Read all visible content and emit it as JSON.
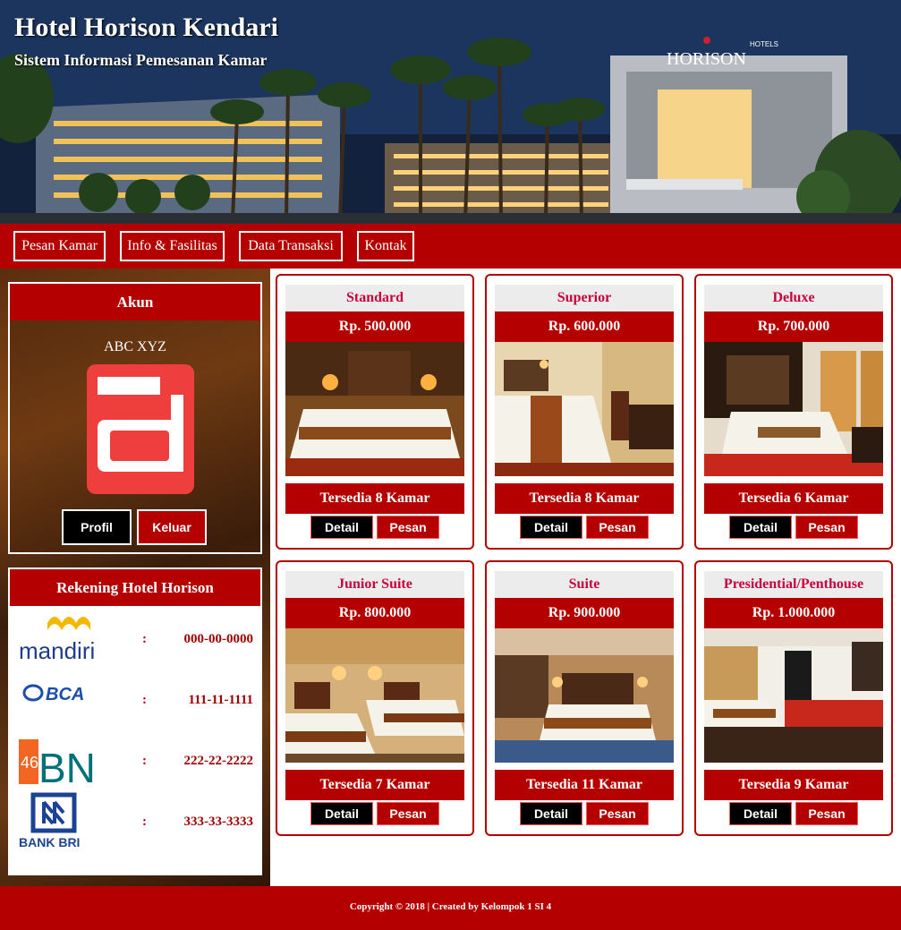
{
  "header": {
    "title": "Hotel Horison Kendari",
    "subtitle": "Sistem Informasi Pemesanan Kamar",
    "building_sign": "HORISON",
    "building_sign_small": "HOTELS"
  },
  "nav": {
    "items": [
      {
        "label": "Pesan Kamar"
      },
      {
        "label": "Info & Fasilitas"
      },
      {
        "label": "Data Transaksi"
      },
      {
        "label": "Kontak"
      }
    ]
  },
  "account": {
    "title": "Akun",
    "user_name": "ABC XYZ",
    "avatar_letter": "a",
    "profile_label": "Profil",
    "logout_label": "Keluar"
  },
  "rekening": {
    "title": "Rekening Hotel Horison",
    "separator": ":",
    "banks": [
      {
        "bank": "mandiri",
        "number": "000-00-0000"
      },
      {
        "bank": "BCA",
        "number": "111-11-1111"
      },
      {
        "bank": "BNI",
        "number": "222-22-2222"
      },
      {
        "bank": "BANK BRI",
        "number": "333-33-3333"
      }
    ]
  },
  "rooms": [
    {
      "name": "Standard",
      "price": "Rp. 500.000",
      "availability": "Tersedia 8 Kamar",
      "detail_label": "Detail",
      "book_label": "Pesan"
    },
    {
      "name": "Superior",
      "price": "Rp. 600.000",
      "availability": "Tersedia 8 Kamar",
      "detail_label": "Detail",
      "book_label": "Pesan"
    },
    {
      "name": "Deluxe",
      "price": "Rp. 700.000",
      "availability": "Tersedia 6 Kamar",
      "detail_label": "Detail",
      "book_label": "Pesan"
    },
    {
      "name": "Junior Suite",
      "price": "Rp. 800.000",
      "availability": "Tersedia 7 Kamar",
      "detail_label": "Detail",
      "book_label": "Pesan"
    },
    {
      "name": "Suite",
      "price": "Rp. 900.000",
      "availability": "Tersedia 11 Kamar",
      "detail_label": "Detail",
      "book_label": "Pesan"
    },
    {
      "name": "Presidential/Penthouse",
      "price": "Rp. 1.000.000",
      "availability": "Tersedia 9 Kamar",
      "detail_label": "Detail",
      "book_label": "Pesan"
    }
  ],
  "footer": {
    "text": "Copyright © 2018 | Created by Kelompok 1 SI 4"
  },
  "colors": {
    "primary_red": "#b50000",
    "room_name": "#c8003c",
    "account_number": "#a00000"
  }
}
